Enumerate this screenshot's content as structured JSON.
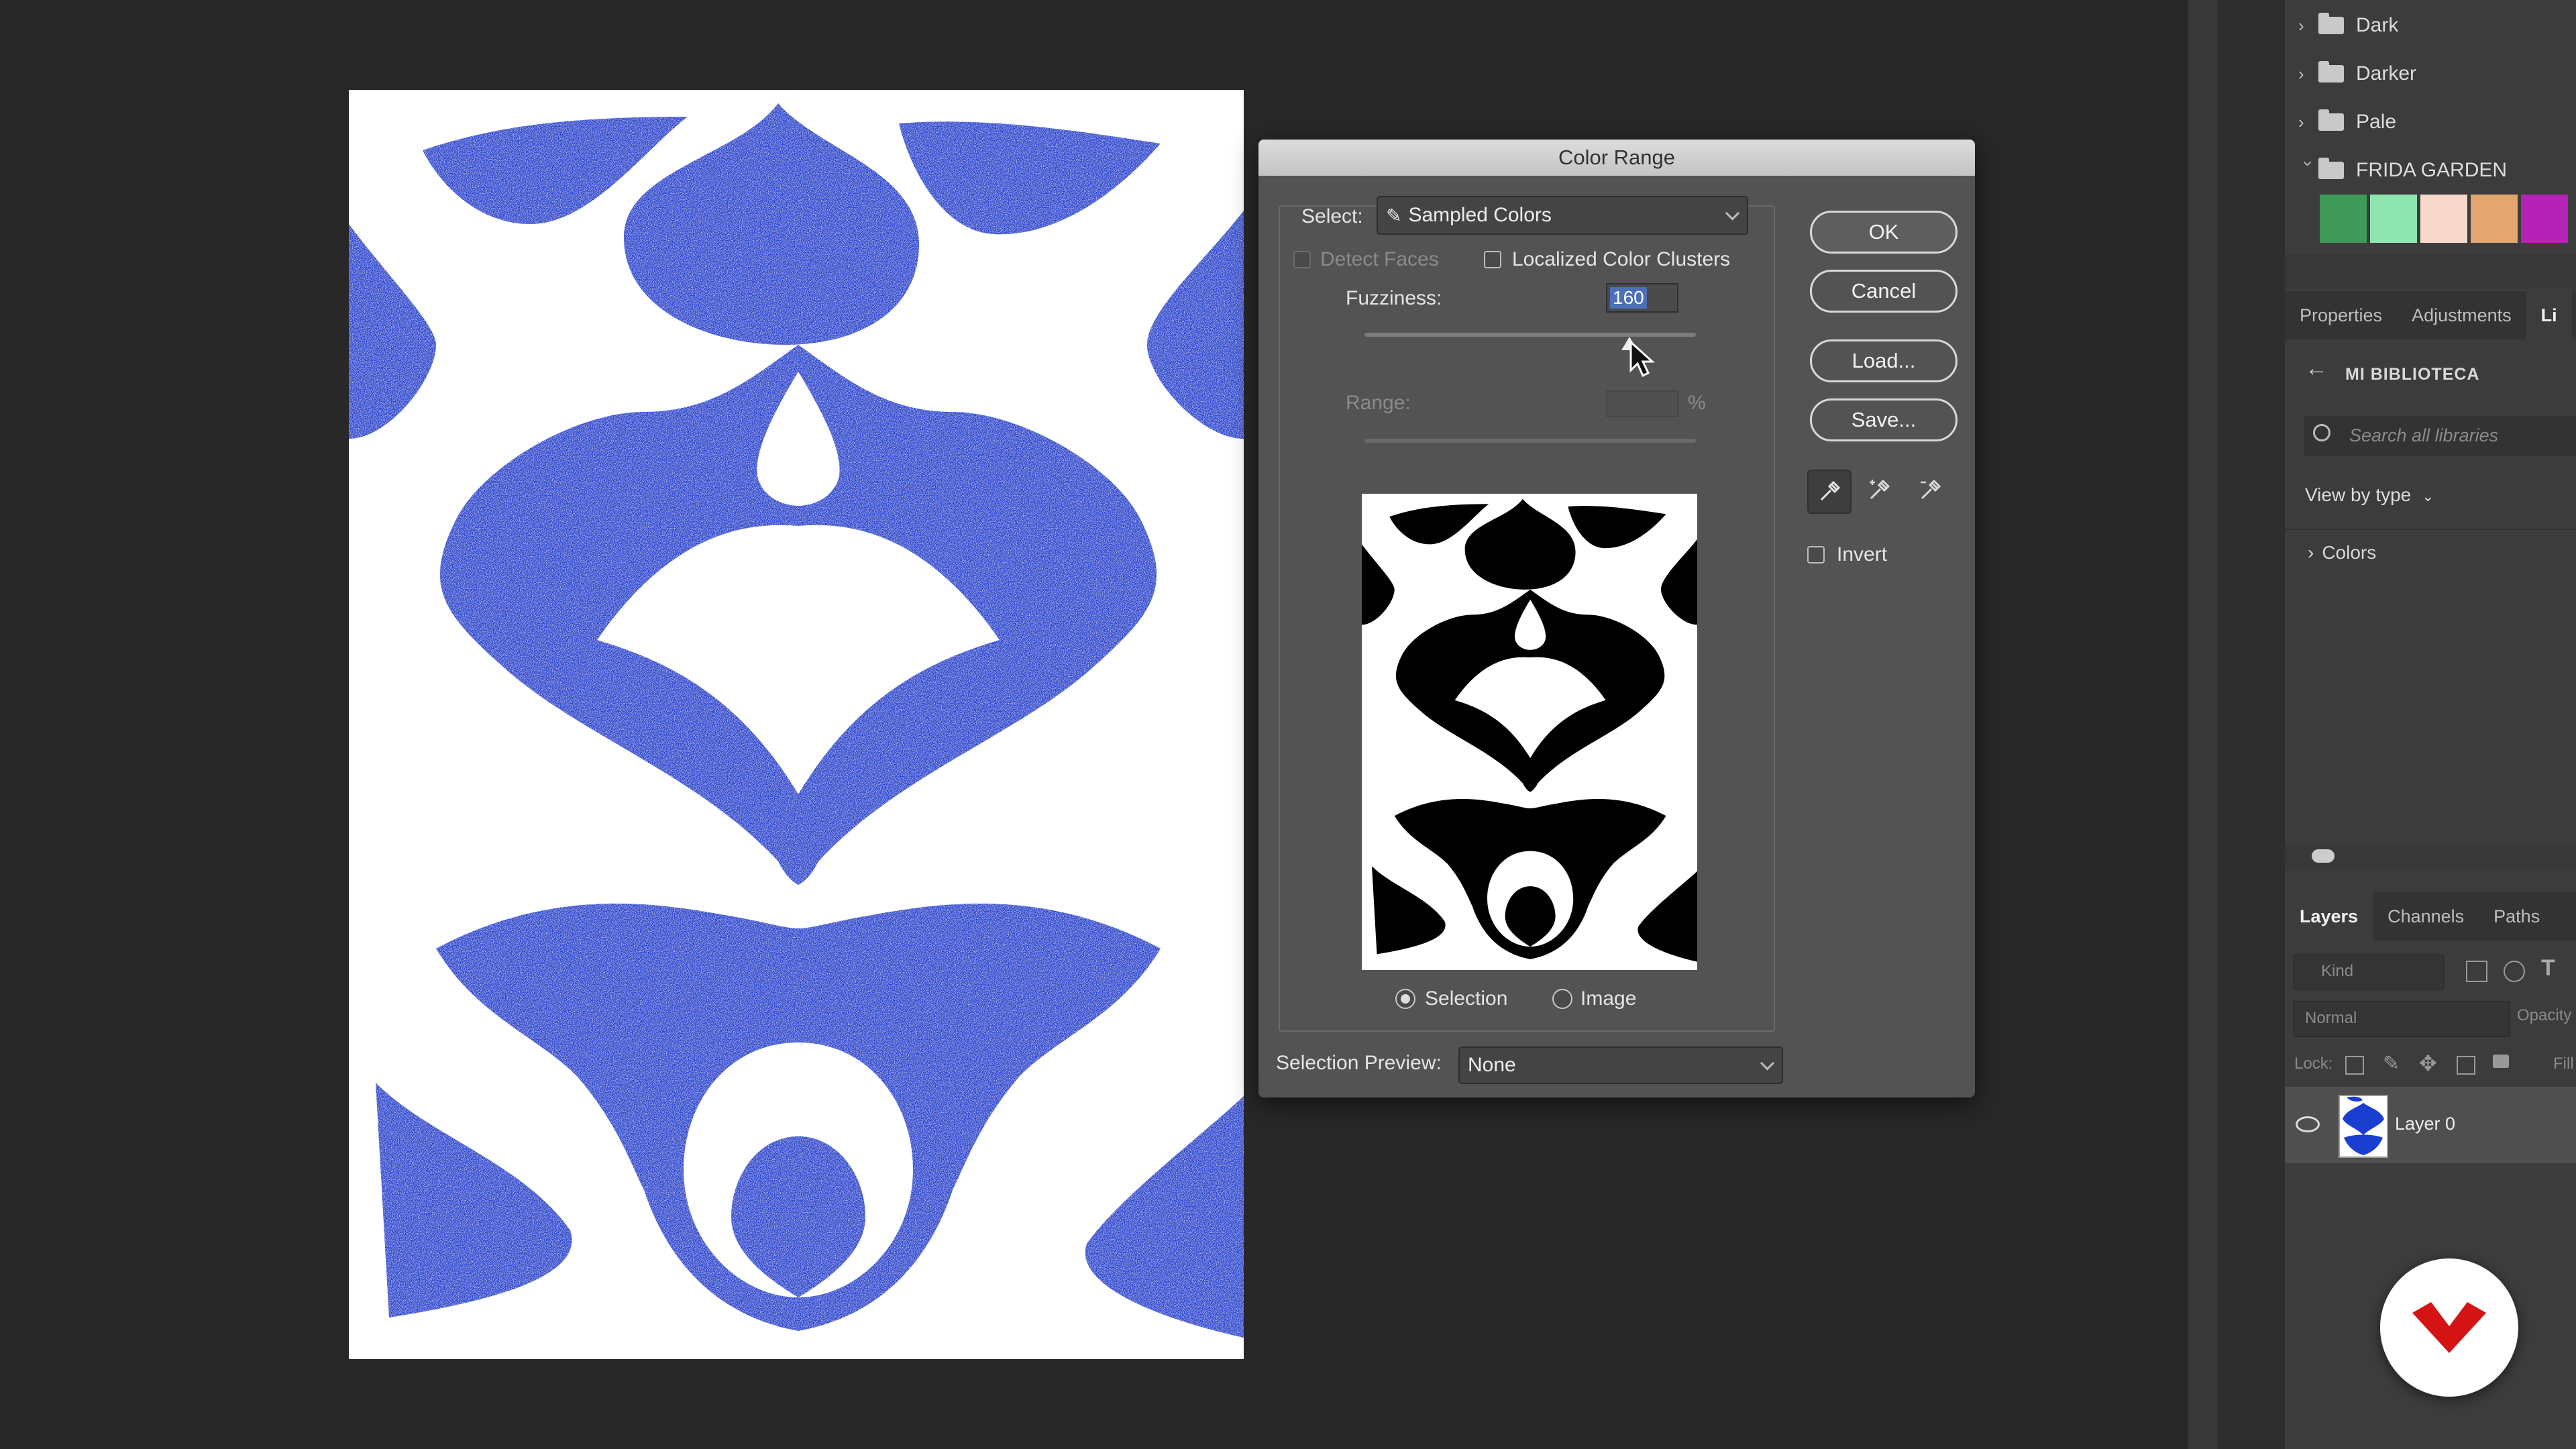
{
  "swatch_groups": [
    {
      "name": "Dark",
      "expanded": false
    },
    {
      "name": "Darker",
      "expanded": false
    },
    {
      "name": "Pale",
      "expanded": false
    },
    {
      "name": "FRIDA GARDEN",
      "expanded": true
    }
  ],
  "swatches": [
    "#3f9a5a",
    "#8ee5b0",
    "#f8d8cc",
    "#e2a66e",
    "#b522b8"
  ],
  "panel_tabs_top": [
    "Properties",
    "Adjustments",
    "Li"
  ],
  "library": {
    "name": "MI BIBLIOTECA",
    "search_placeholder": "Search all libraries",
    "view_by": "View by type",
    "section": "Colors"
  },
  "layers_tabs": [
    "Layers",
    "Channels",
    "Paths"
  ],
  "layers": {
    "kind_placeholder": "Kind",
    "blend_mode": "Normal",
    "opacity_label": "Opacity",
    "lock_label": "Lock:",
    "fill_label": "Fill",
    "layer_name": "Layer 0"
  },
  "dialog": {
    "title": "Color Range",
    "select_label": "Select:",
    "select_value": "Sampled Colors",
    "detect_faces": "Detect Faces",
    "localized_clusters": "Localized Color Clusters",
    "fuzziness_label": "Fuzziness:",
    "fuzziness_value": "160",
    "fuzziness_fraction": 0.8,
    "range_label": "Range:",
    "range_unit": "%",
    "radio_selection": "Selection",
    "radio_image": "Image",
    "selection_preview_label": "Selection Preview:",
    "selection_preview_value": "None",
    "buttons": {
      "ok": "OK",
      "cancel": "Cancel",
      "load": "Load...",
      "save": "Save..."
    },
    "invert_label": "Invert"
  },
  "colors": {
    "ink": "#1a3fd0",
    "dialog_bg": "#535353",
    "logo_red": "#d41414"
  }
}
